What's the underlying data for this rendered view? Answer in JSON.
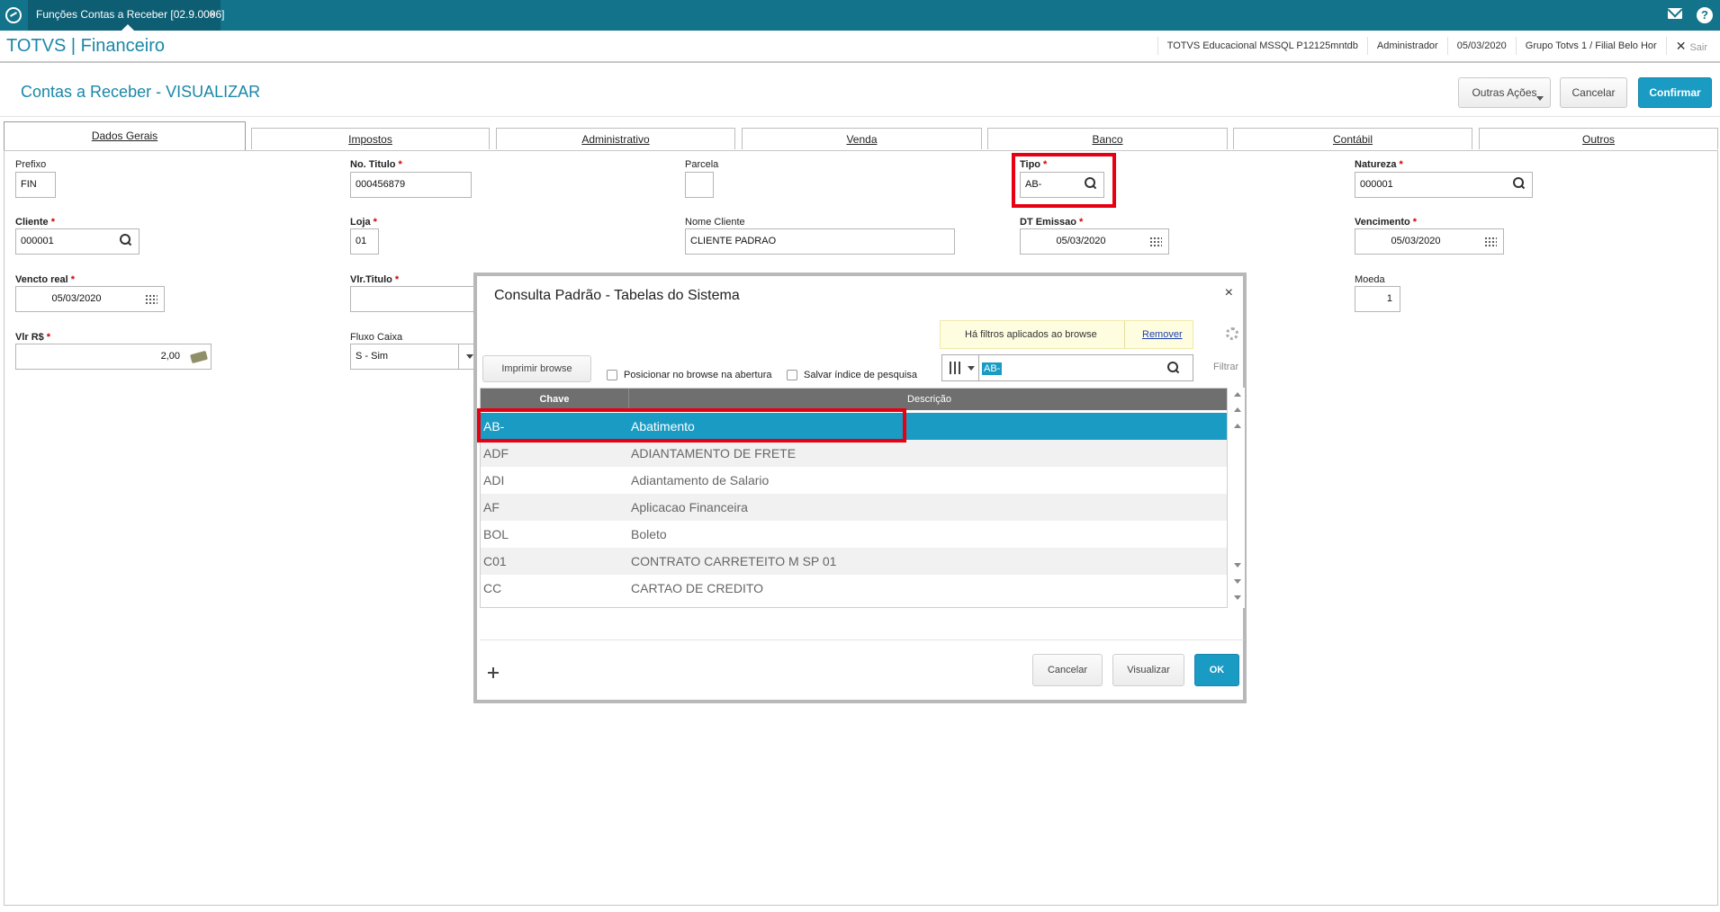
{
  "topbar": {
    "tab_title": "Funções Contas a Receber [02.9.0006]",
    "tab_close": "×"
  },
  "header": {
    "app_title": "TOTVS | Financeiro",
    "environment": "TOTVS Educacional MSSQL P12125mntdb",
    "user": "Administrador",
    "date": "05/03/2020",
    "company": "Grupo Totvs 1 / Filial Belo Hor",
    "exit_label": "Sair"
  },
  "form": {
    "title": "Contas a Receber - VISUALIZAR",
    "actions": {
      "outras": "Outras Ações",
      "cancelar": "Cancelar",
      "confirmar": "Confirmar"
    },
    "tabs": [
      "Dados Gerais",
      "Impostos",
      "Administrativo",
      "Venda",
      "Banco",
      "Contábil",
      "Outros"
    ],
    "fields": {
      "prefixo": {
        "label": "Prefixo",
        "value": "FIN"
      },
      "no_titulo": {
        "label": "No. Titulo",
        "value": "000456879"
      },
      "parcela": {
        "label": "Parcela",
        "value": ""
      },
      "tipo": {
        "label": "Tipo",
        "value": "AB-"
      },
      "natureza": {
        "label": "Natureza",
        "value": "000001"
      },
      "cliente": {
        "label": "Cliente",
        "value": "000001"
      },
      "loja": {
        "label": "Loja",
        "value": "01"
      },
      "nome_cliente": {
        "label": "Nome Cliente",
        "value": "CLIENTE PADRAO"
      },
      "dt_emissao": {
        "label": "DT Emissao",
        "value": "05/03/2020"
      },
      "vencimento": {
        "label": "Vencimento",
        "value": "05/03/2020"
      },
      "vencto_real": {
        "label": "Vencto real",
        "value": "05/03/2020"
      },
      "vlr_titulo": {
        "label": "Vlr.Titulo",
        "value": ""
      },
      "moeda": {
        "label": "Moeda",
        "value": "1"
      },
      "vlr_rs": {
        "label": "Vlr R$",
        "value": "2,00"
      },
      "fluxo_caixa": {
        "label": "Fluxo Caixa",
        "value": "S - Sim"
      }
    },
    "required_mark": "*"
  },
  "dialog": {
    "title": "Consulta Padrão - Tabelas do Sistema",
    "close": "×",
    "filter_notice": "Há filtros aplicados ao browse",
    "remove_link": "Remover",
    "print_button": "Imprimir browse",
    "check_position": "Posicionar no browse na abertura",
    "check_save_index": "Salvar índice de pesquisa",
    "search_value": "AB-",
    "filter_label": "Filtrar",
    "columns": [
      "Chave",
      "Descrição"
    ],
    "rows": [
      {
        "key": "AB-",
        "desc": "Abatimento"
      },
      {
        "key": "ADF",
        "desc": "ADIANTAMENTO DE FRETE"
      },
      {
        "key": "ADI",
        "desc": "Adiantamento de Salario"
      },
      {
        "key": "AF",
        "desc": "Aplicacao Financeira"
      },
      {
        "key": "BOL",
        "desc": "Boleto"
      },
      {
        "key": "C01",
        "desc": "CONTRATO CARRETEITO M SP 01"
      },
      {
        "key": "CC",
        "desc": "CARTAO DE CREDITO"
      }
    ],
    "buttons": {
      "cancelar": "Cancelar",
      "visualizar": "Visualizar",
      "ok": "OK"
    }
  },
  "colors": {
    "topbar": "#13738a",
    "accent": "#1a9bc4",
    "title": "#1a87a8",
    "highlight_box": "#e60012"
  }
}
